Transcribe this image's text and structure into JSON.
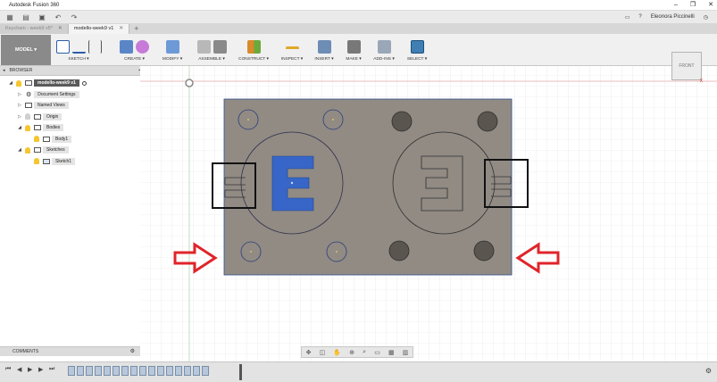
{
  "app": {
    "title": "Autodesk Fusion 360"
  },
  "window_controls": {
    "minimize": "–",
    "maximize": "❐",
    "close": "✕"
  },
  "quick_access": {
    "user_name": "Eleonora Piccinelli"
  },
  "tabs": [
    {
      "label": "Keychain - week9 v5*",
      "active": false
    },
    {
      "label": "modello-week9 v1",
      "active": true
    }
  ],
  "toolbar": {
    "workspace": "MODEL ▾",
    "groups": [
      {
        "label": "SKETCH ▾"
      },
      {
        "label": "CREATE ▾"
      },
      {
        "label": "MODIFY ▾"
      },
      {
        "label": "ASSEMBLE ▾"
      },
      {
        "label": "CONSTRUCT ▾"
      },
      {
        "label": "INSPECT ▾"
      },
      {
        "label": "INSERT ▾"
      },
      {
        "label": "MAKE ▾"
      },
      {
        "label": "ADD-INS ▾"
      },
      {
        "label": "SELECT ▾"
      }
    ]
  },
  "browser": {
    "title": "BROWSER",
    "nodes": {
      "root": "modello-week9 v1",
      "document_settings": "Document Settings",
      "named_views": "Named Views",
      "origin": "Origin",
      "bodies": "Bodies",
      "body1": "Body1",
      "sketches": "Sketches",
      "sketch1": "Sketch1"
    }
  },
  "comments": {
    "label": "COMMENTS"
  },
  "viewcube": {
    "face": "FRONT",
    "axis": "X"
  },
  "viewport": {
    "left_letter": "E",
    "right_letter": "Ǝ",
    "colors": {
      "plate": "#918b84",
      "letter_blue": "#3766c8",
      "arrow_red": "#e0242a",
      "hole_dark": "#5a554f"
    }
  },
  "timeline": {
    "item_count": 16
  }
}
